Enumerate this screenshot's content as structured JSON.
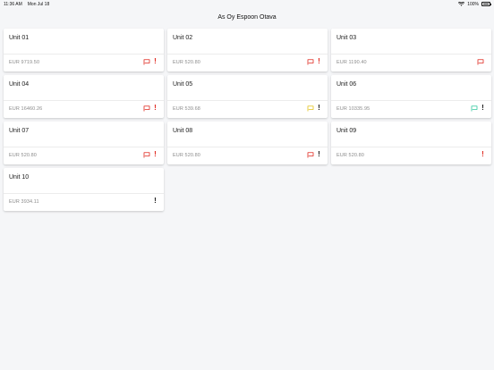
{
  "status": {
    "time": "11:36 AM",
    "date": "Mon Jul 18",
    "battery": "100%",
    "wifi_icon": "wifi-icon",
    "battery_icon": "battery-icon"
  },
  "nav": {
    "title": "As Oy Espoon Otava"
  },
  "colors": {
    "red": "#e0281f",
    "yellow": "#e2c21a",
    "teal": "#2fc79c",
    "black": "#1a1a1a"
  },
  "units": [
    {
      "name": "Unit 01",
      "amount": "EUR 9719.50",
      "flag": "red",
      "alert": "red"
    },
    {
      "name": "Unit 02",
      "amount": "EUR 520.80",
      "flag": "red",
      "alert": "red"
    },
    {
      "name": "Unit 03",
      "amount": "EUR 1190.40",
      "flag": "red",
      "alert": null
    },
    {
      "name": "Unit 04",
      "amount": "EUR 16460.26",
      "flag": "red",
      "alert": "red"
    },
    {
      "name": "Unit 05",
      "amount": "EUR 539.68",
      "flag": "yellow",
      "alert": "black"
    },
    {
      "name": "Unit 06",
      "amount": "EUR 10335.95",
      "flag": "teal",
      "alert": "black"
    },
    {
      "name": "Unit 07",
      "amount": "EUR 520.80",
      "flag": "red",
      "alert": "red"
    },
    {
      "name": "Unit 08",
      "amount": "EUR 520.80",
      "flag": "red",
      "alert": "black"
    },
    {
      "name": "Unit 09",
      "amount": "EUR 520.80",
      "flag": null,
      "alert": "red"
    },
    {
      "name": "Unit 10",
      "amount": "EUR 3934.11",
      "flag": null,
      "alert": "black"
    }
  ]
}
